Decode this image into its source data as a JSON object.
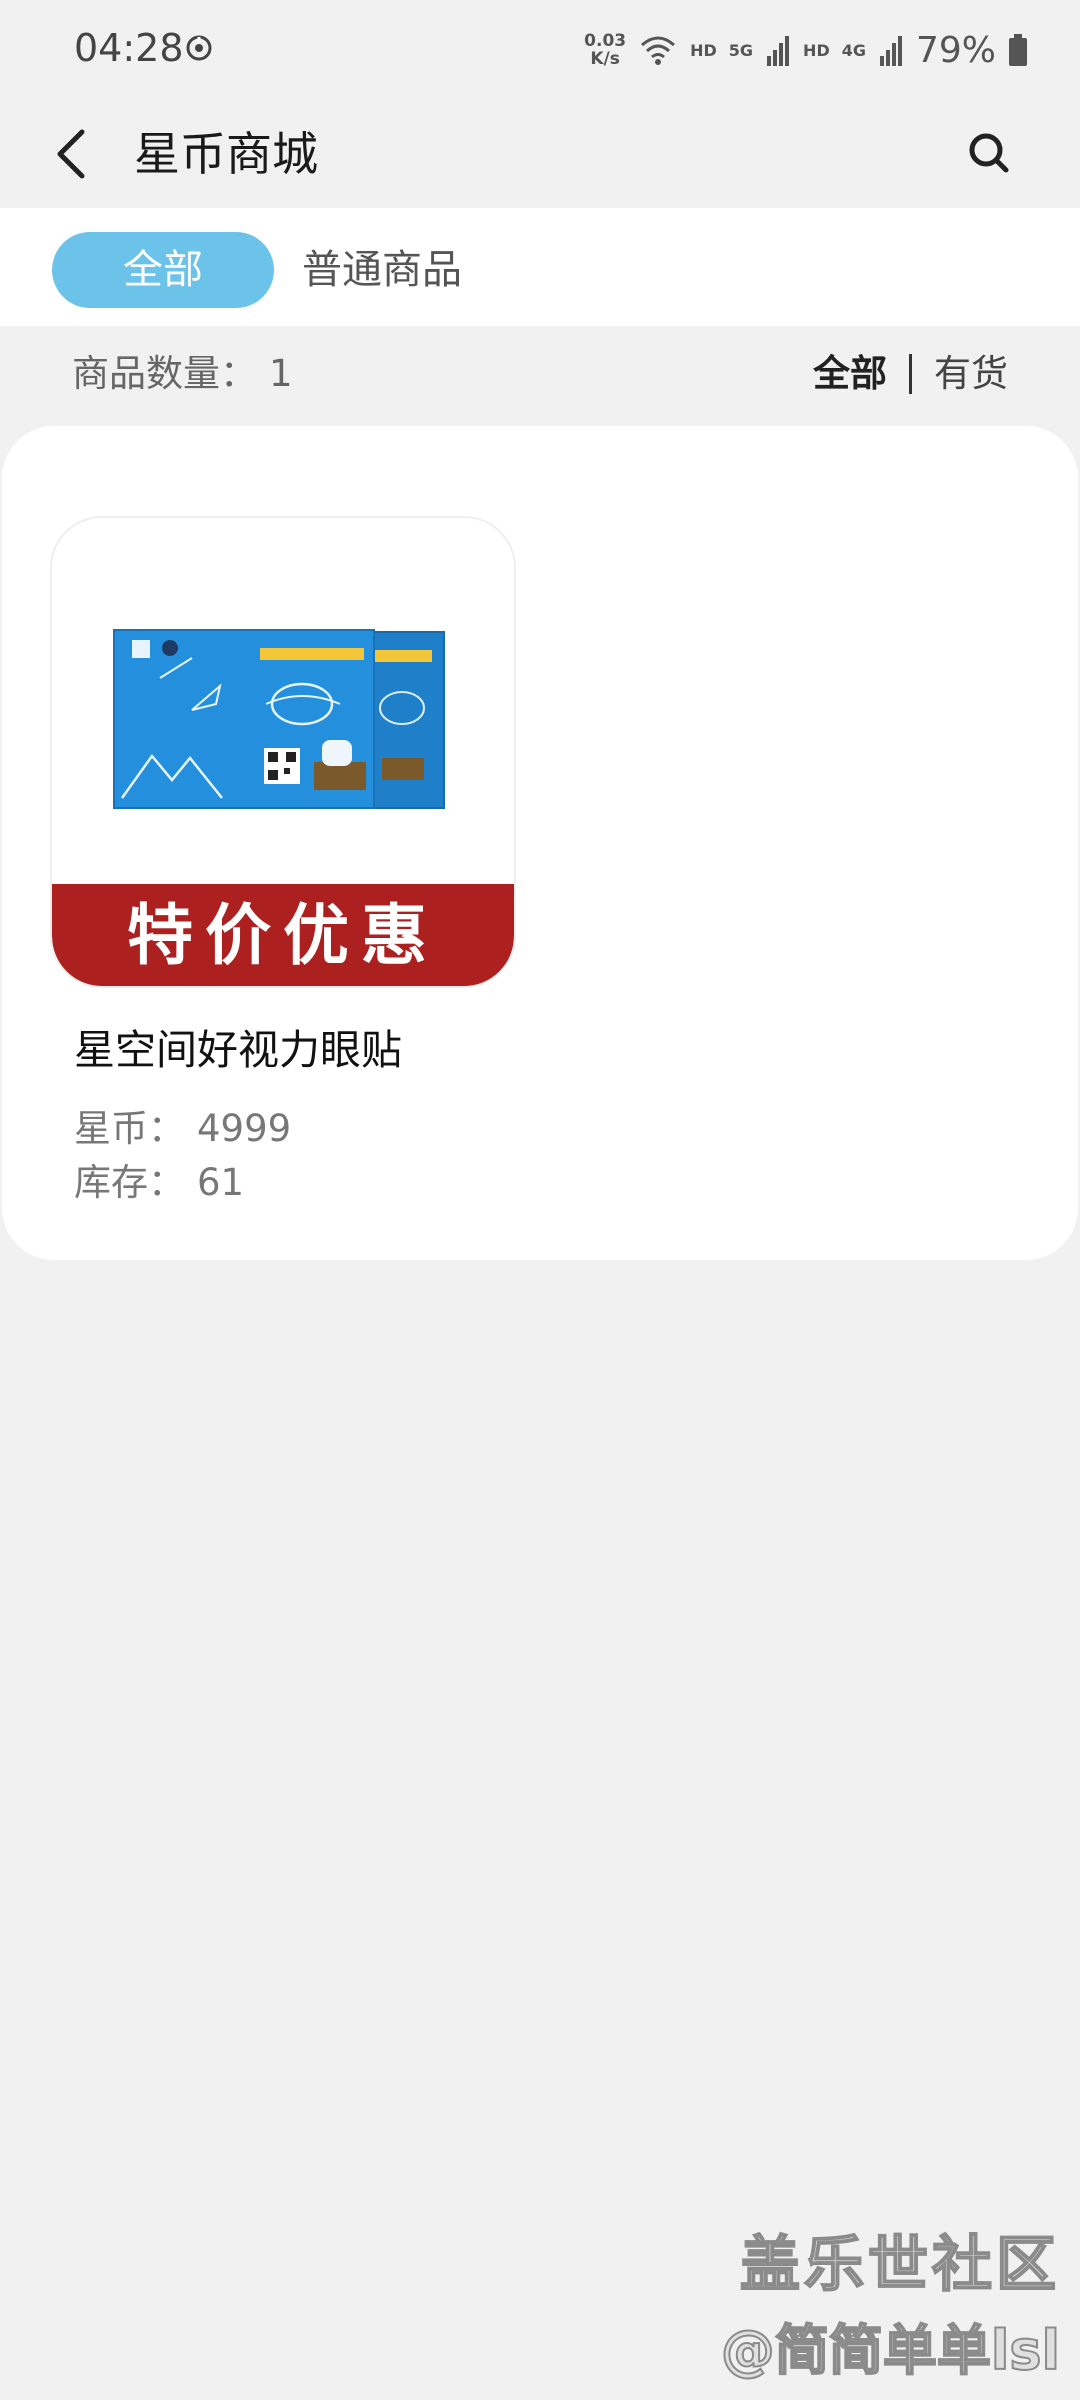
{
  "status_bar": {
    "time": "04:28",
    "net_speed_value": "0.03",
    "net_speed_unit": "K/s",
    "hd1": "HD",
    "net1": "5G",
    "hd2": "HD",
    "net2": "4G",
    "battery": "79%",
    "icons": [
      "sync-icon",
      "wifi-icon",
      "signal-icon",
      "signal-icon",
      "battery-icon"
    ]
  },
  "app_bar": {
    "title": "星币商城",
    "icons": [
      "back-arrow-icon",
      "search-icon"
    ]
  },
  "tabs": [
    {
      "label": "全部",
      "selected": true
    },
    {
      "label": "普通商品",
      "selected": false
    }
  ],
  "count_row": {
    "label": "商品数量：",
    "value": "1",
    "filters": [
      {
        "label": "全部",
        "active": true
      },
      {
        "label": "有货",
        "active": false
      }
    ]
  },
  "products": [
    {
      "image_name": "eye-patch-product-image",
      "promo_label": "特价优惠",
      "name": "星空间好视力眼贴",
      "coins_label": "星币：",
      "coins_value": "4999",
      "stock_label": "库存：",
      "stock_value": "61"
    }
  ],
  "watermark": {
    "line1": "盖乐世社区",
    "line2": "@简简单单lsl"
  },
  "colors": {
    "accent": "#6cc3ea",
    "promo_red": "#ac2120",
    "background": "#f1f1f1"
  }
}
